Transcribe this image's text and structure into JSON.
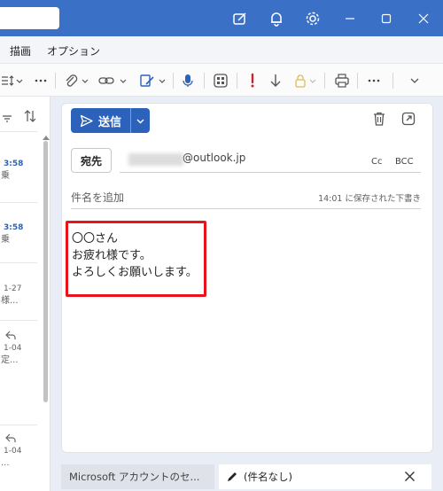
{
  "titlebar": {
    "icons": [
      "compose-icon",
      "bell-icon",
      "gear-icon",
      "minimize-icon",
      "maximize-icon",
      "close-icon"
    ]
  },
  "menu": {
    "items": [
      "描画",
      "オプション"
    ]
  },
  "toolbar": {
    "icons": [
      "format-icon",
      "more-icon",
      "paperclip-icon",
      "link-icon",
      "signature-icon",
      "microphone-icon",
      "apps-icon",
      "importance-high-icon",
      "importance-low-icon",
      "lock-icon",
      "print-icon",
      "more-icon",
      "expand-icon"
    ]
  },
  "message_list": {
    "items": [
      {
        "time": "3:58",
        "snippet": "乗"
      },
      {
        "time": "3:58",
        "snippet": "乗"
      },
      {
        "time": "1-27",
        "snippet": "様..."
      },
      {
        "time": "1-04",
        "snippet": "定..."
      },
      {
        "time": "1-04",
        "snippet": "..."
      }
    ]
  },
  "compose": {
    "send_label": "送信",
    "to_label": "宛先",
    "to_value_suffix": "@outlook.jp",
    "cc_label": "Cc",
    "bcc_label": "BCC",
    "subject_placeholder": "件名を追加",
    "draft_status": "14:01 に保存された下書き",
    "body_lines": [
      "〇〇さん",
      "お疲れ様です。",
      "よろしくお願いします。"
    ],
    "highlight_color": "#e8131b"
  },
  "tabs": [
    {
      "label": "Microsoft アカウントのセ..."
    },
    {
      "label": "(件名なし)"
    }
  ],
  "colors": {
    "accent": "#2c62b9",
    "titlebar": "#3a70c6"
  }
}
